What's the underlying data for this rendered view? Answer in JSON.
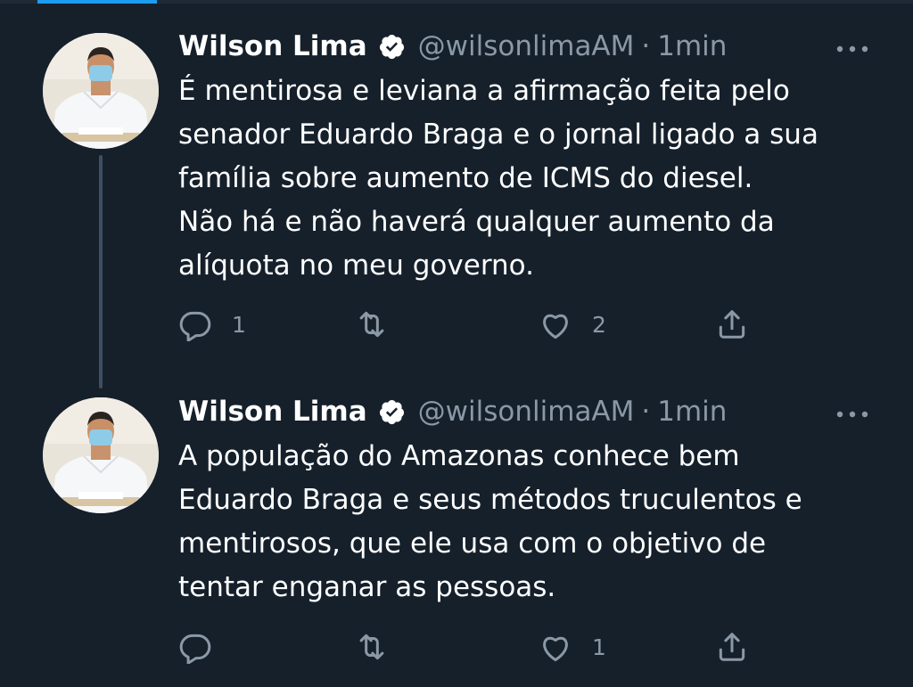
{
  "colors": {
    "background": "#15202b",
    "text": "#ffffff",
    "secondary": "#8b98a5",
    "accent": "#1d9bf0",
    "thread_line": "#3d4f60"
  },
  "tweets": [
    {
      "name": "Wilson Lima",
      "verified": true,
      "handle": "@wilsonlimaAM",
      "separator": "·",
      "time": "1min",
      "text_lines": [
        "É mentirosa e leviana a afirmação feita pelo",
        "senador Eduardo Braga e o jornal ligado a sua",
        "família sobre aumento de ICMS do diesel.",
        "Não há e não haverá qualquer aumento da",
        "alíquota no meu governo."
      ],
      "replies": "1",
      "retweets": "",
      "likes": "2",
      "icons": [
        "reply-icon",
        "retweet-icon",
        "like-icon",
        "share-icon",
        "more-icon",
        "verified-badge-icon"
      ]
    },
    {
      "name": "Wilson Lima",
      "verified": true,
      "handle": "@wilsonlimaAM",
      "separator": "·",
      "time": "1min",
      "text_lines": [
        "A população do Amazonas conhece bem",
        "Eduardo Braga e seus métodos truculentos e",
        "mentirosos, que ele usa com o objetivo de",
        "tentar enganar as pessoas."
      ],
      "replies": "",
      "retweets": "",
      "likes": "1",
      "icons": [
        "reply-icon",
        "retweet-icon",
        "like-icon",
        "share-icon",
        "more-icon",
        "verified-badge-icon"
      ]
    }
  ]
}
